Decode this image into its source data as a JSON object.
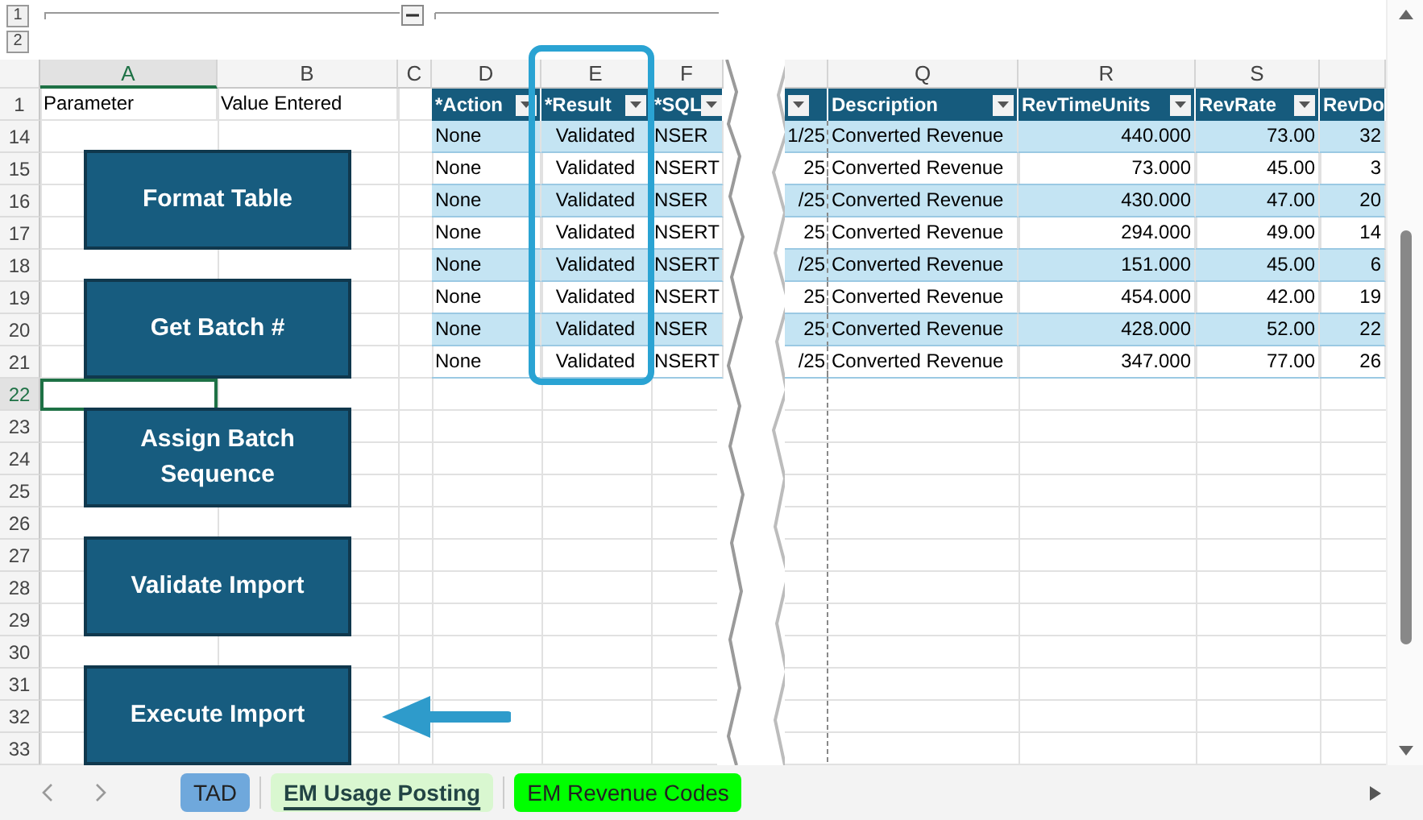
{
  "outline": {
    "levels": [
      "1",
      "2"
    ]
  },
  "columns_left": [
    {
      "label": "A",
      "selected": true
    },
    {
      "label": "B",
      "selected": false
    },
    {
      "label": "C",
      "selected": false
    },
    {
      "label": "D",
      "selected": false
    },
    {
      "label": "E",
      "selected": false
    },
    {
      "label": "F",
      "selected": false
    }
  ],
  "columns_right": [
    {
      "label": "Q",
      "selected": false
    },
    {
      "label": "R",
      "selected": false
    },
    {
      "label": "S",
      "selected": false
    }
  ],
  "rows": [
    {
      "label": "1",
      "selected": false
    },
    {
      "label": "14",
      "selected": false
    },
    {
      "label": "15",
      "selected": false
    },
    {
      "label": "16",
      "selected": false
    },
    {
      "label": "17",
      "selected": false
    },
    {
      "label": "18",
      "selected": false
    },
    {
      "label": "19",
      "selected": false
    },
    {
      "label": "20",
      "selected": false
    },
    {
      "label": "21",
      "selected": false
    },
    {
      "label": "22",
      "selected": true
    },
    {
      "label": "23",
      "selected": false
    },
    {
      "label": "24",
      "selected": false
    },
    {
      "label": "25",
      "selected": false
    },
    {
      "label": "26",
      "selected": false
    },
    {
      "label": "27",
      "selected": false
    },
    {
      "label": "28",
      "selected": false
    },
    {
      "label": "29",
      "selected": false
    },
    {
      "label": "30",
      "selected": false
    },
    {
      "label": "31",
      "selected": false
    },
    {
      "label": "32",
      "selected": false
    },
    {
      "label": "33",
      "selected": false
    }
  ],
  "header_cells": [
    "Parameter",
    "Value Entered"
  ],
  "table_headers_left": [
    "*Action",
    "*Result",
    "*SQL"
  ],
  "table_headers_right": [
    "Description",
    "RevTimeUnits",
    "RevRate",
    "RevDo"
  ],
  "data_rows": [
    {
      "action": "None",
      "result": "Validated",
      "sql": "NSER",
      "date": "1/25",
      "description": "Converted Revenue",
      "units": "440.000",
      "rate": "73.00",
      "rev_do": "32"
    },
    {
      "action": "None",
      "result": "Validated",
      "sql": "NSERT",
      "date": "25",
      "description": "Converted Revenue",
      "units": "73.000",
      "rate": "45.00",
      "rev_do": "3"
    },
    {
      "action": "None",
      "result": "Validated",
      "sql": "NSER",
      "date": "/25",
      "description": "Converted Revenue",
      "units": "430.000",
      "rate": "47.00",
      "rev_do": "20"
    },
    {
      "action": "None",
      "result": "Validated",
      "sql": "NSERT",
      "date": "25",
      "description": "Converted Revenue",
      "units": "294.000",
      "rate": "49.00",
      "rev_do": "14"
    },
    {
      "action": "None",
      "result": "Validated",
      "sql": "NSERT",
      "date": "/25",
      "description": "Converted Revenue",
      "units": "151.000",
      "rate": "45.00",
      "rev_do": "6"
    },
    {
      "action": "None",
      "result": "Validated",
      "sql": "NSERT",
      "date": "25",
      "description": "Converted Revenue",
      "units": "454.000",
      "rate": "42.00",
      "rev_do": "19"
    },
    {
      "action": "None",
      "result": "Validated",
      "sql": "NSER",
      "date": "25",
      "description": "Converted Revenue",
      "units": "428.000",
      "rate": "52.00",
      "rev_do": "22"
    },
    {
      "action": "None",
      "result": "Validated",
      "sql": "NSERT",
      "date": "/25",
      "description": "Converted Revenue",
      "units": "347.000",
      "rate": "77.00",
      "rev_do": "26"
    }
  ],
  "shapes": [
    {
      "label": "Format Table"
    },
    {
      "label": "Get Batch #"
    },
    {
      "label": "Assign Batch Sequence"
    },
    {
      "label": "Validate Import"
    },
    {
      "label": "Execute Import"
    }
  ],
  "tabs": [
    {
      "label": "TAD",
      "selected": false,
      "color": "#6fa8dc"
    },
    {
      "label": "EM Usage Posting",
      "selected": true,
      "color": "#d9f7d0"
    },
    {
      "label": "EM Revenue Codes",
      "selected": false,
      "color": "#00ff00"
    }
  ]
}
